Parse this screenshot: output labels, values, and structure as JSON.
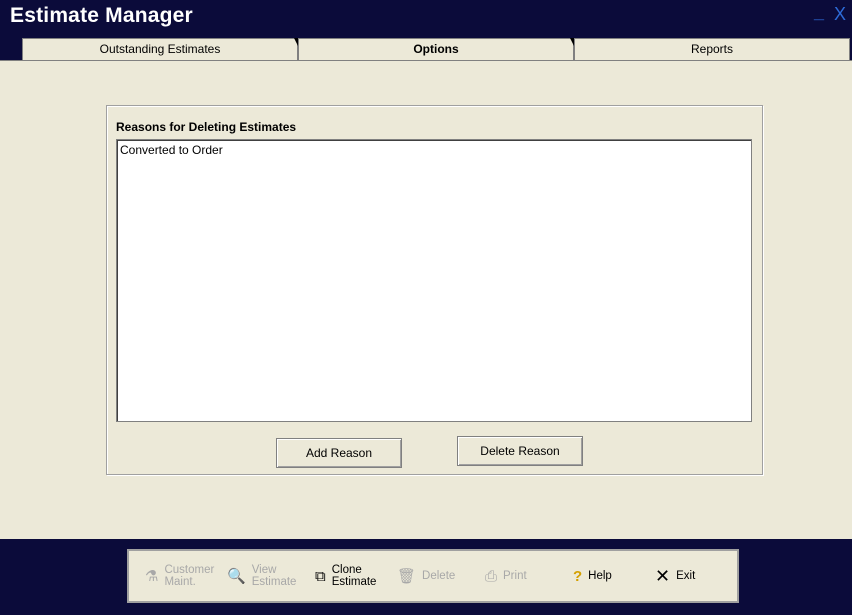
{
  "window": {
    "title": "Estimate Manager",
    "minimize": "_",
    "close": "X"
  },
  "tabs": [
    {
      "label": "Outstanding Estimates",
      "active": false
    },
    {
      "label": "Options",
      "active": true
    },
    {
      "label": "Reports",
      "active": false
    }
  ],
  "options": {
    "group_title": "Reasons for Deleting Estimates",
    "reasons": [
      "Converted to Order"
    ],
    "add_reason_label": "Add Reason",
    "delete_reason_label": "Delete Reason"
  },
  "toolbar": {
    "customer_maint": {
      "line1": "Customer",
      "line2": "Maint.",
      "enabled": false,
      "icon": "person-icon"
    },
    "view_estimate": {
      "line1": "View",
      "line2": "Estimate",
      "enabled": false,
      "icon": "magnify-document-icon"
    },
    "clone_estimate": {
      "line1": "Clone",
      "line2": "Estimate",
      "enabled": true,
      "icon": "copy-documents-icon"
    },
    "delete": {
      "label": "Delete",
      "enabled": false,
      "icon": "trash-icon"
    },
    "print": {
      "label": "Print",
      "enabled": false,
      "icon": "printer-icon"
    },
    "help": {
      "label": "Help",
      "enabled": true,
      "icon": "question-icon"
    },
    "exit": {
      "label": "Exit",
      "enabled": true,
      "icon": "x-icon"
    }
  }
}
